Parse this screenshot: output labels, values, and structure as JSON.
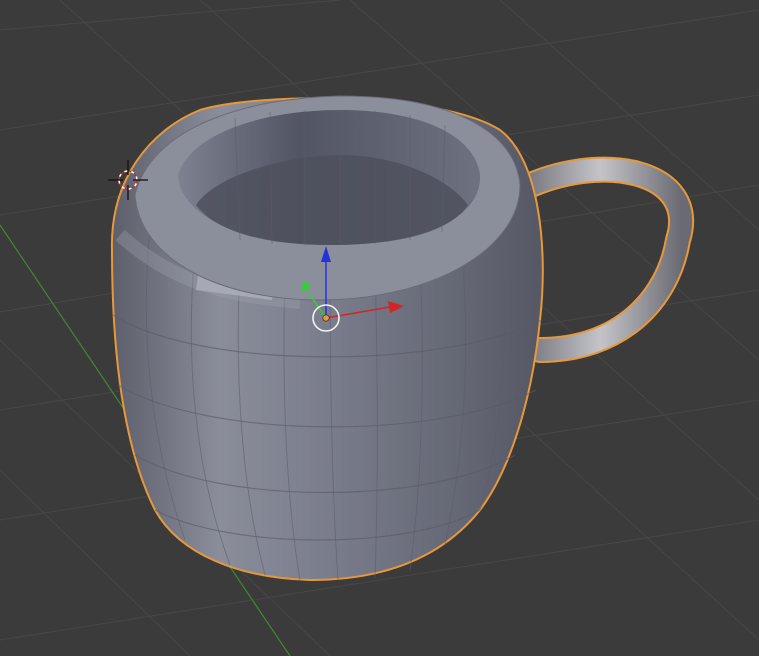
{
  "viewport": {
    "background_color": "#3b3b3b",
    "grid_color": "#474747",
    "x_axis_color": "#8a2a2a",
    "y_axis_color": "#3e8a2e"
  },
  "object": {
    "shape": "mug",
    "selected": true,
    "outline_color": "#e8983a",
    "body_color": "#7a7d8c",
    "handle_color": "#9a9a9a"
  },
  "gizmo": {
    "x_arrow_color": "#d42424",
    "y_arrow_color": "#2bd62b",
    "z_arrow_color": "#2233dd",
    "origin_color": "#e8983a"
  },
  "cursor_3d": {
    "icon": "3d-cursor-icon"
  }
}
